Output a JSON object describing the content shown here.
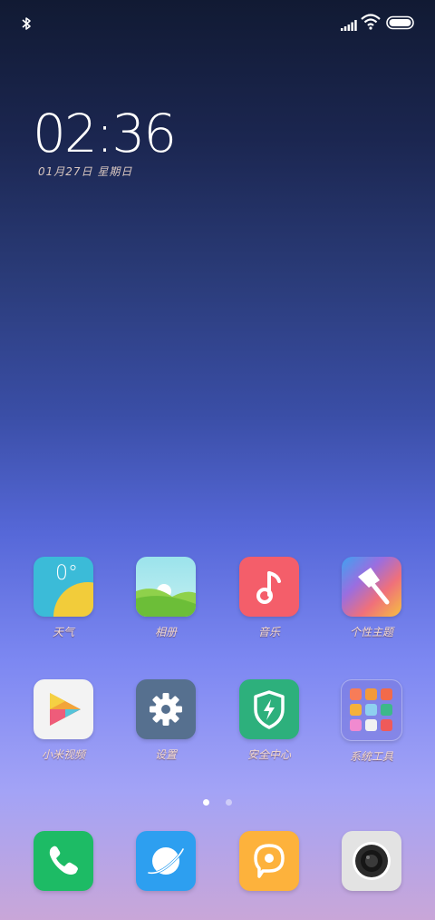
{
  "status": {
    "bluetooth_icon": "bluetooth-icon",
    "signal_icon": "signal-bars-icon",
    "wifi_icon": "wifi-icon",
    "battery_icon": "battery-full-icon"
  },
  "lockscreen": {
    "time": "02:36",
    "date": "01月27日  星期日"
  },
  "home": {
    "row1": [
      {
        "label": "天气",
        "icon": "weather-icon",
        "temp": "0°"
      },
      {
        "label": "相册",
        "icon": "gallery-icon"
      },
      {
        "label": "音乐",
        "icon": "music-icon"
      },
      {
        "label": "个性主题",
        "icon": "themes-icon"
      }
    ],
    "row2": [
      {
        "label": "小米视频",
        "icon": "video-icon"
      },
      {
        "label": "设置",
        "icon": "settings-gear-icon"
      },
      {
        "label": "安全中心",
        "icon": "security-shield-icon"
      },
      {
        "label": "系统工具",
        "icon": "folder-icon"
      }
    ]
  },
  "pager": {
    "current": 1,
    "total": 2
  },
  "dock": [
    {
      "icon": "phone-icon"
    },
    {
      "icon": "browser-icon"
    },
    {
      "icon": "messages-icon"
    },
    {
      "icon": "camera-icon"
    }
  ],
  "colors": {
    "weather": "#3bbbd8",
    "music": "#f45e6a",
    "settings": "#56708f",
    "security": "#2db07c",
    "phone": "#1dbb65",
    "browser": "#2d9ff0",
    "messages": "#fdb23c",
    "camera": "#e3e3e3"
  }
}
